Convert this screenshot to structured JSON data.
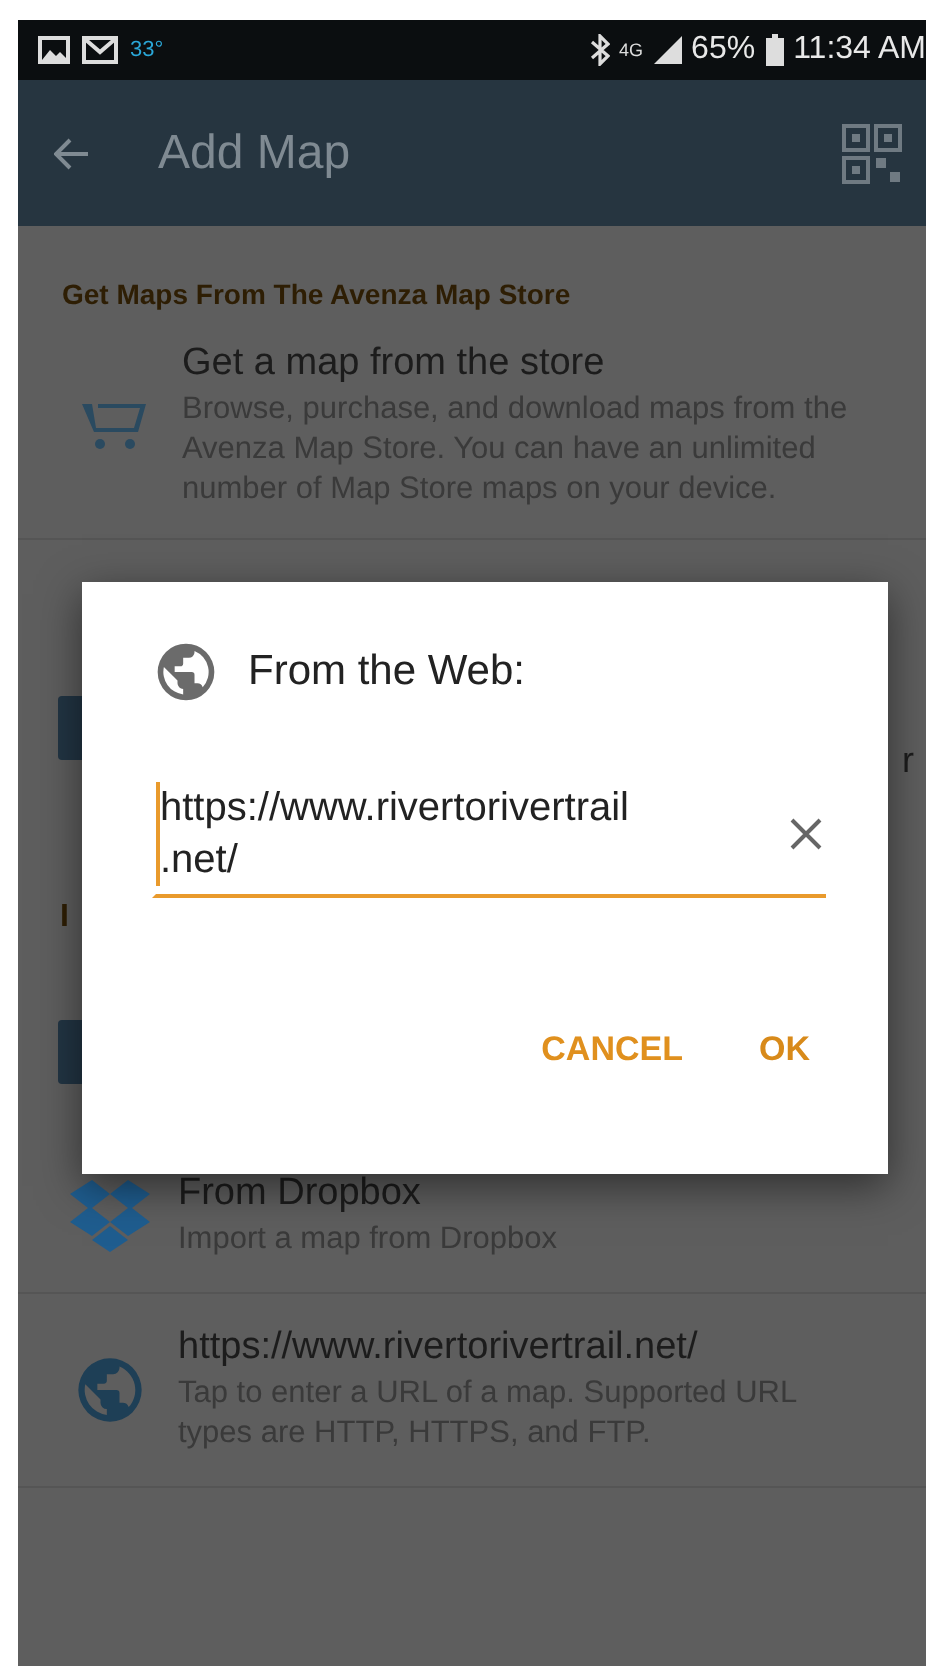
{
  "status_bar": {
    "temperature": "33°",
    "network": "4G",
    "battery": "65%",
    "time": "11:34 AM"
  },
  "app_bar": {
    "title": "Add Map"
  },
  "store_section": {
    "header": "Get Maps From The Avenza Map Store",
    "item": {
      "title": "Get a map from the store",
      "subtitle": "Browse, purchase, and download maps from the Avenza Map Store. You can have an unlimited number of Map Store maps on your device."
    }
  },
  "covered": {
    "row_fragment": "r",
    "header_fragment": "I"
  },
  "dialog": {
    "title": "From the Web:",
    "field": {
      "value": "https://www.rivertorivertrail\n.net/"
    },
    "buttons": [
      {
        "label": "CANCEL",
        "kind": "cancel"
      },
      {
        "label": "OK",
        "kind": "ok"
      }
    ]
  },
  "import_items": [
    {
      "kind": "dropbox",
      "title": "From Dropbox",
      "subtitle": "Import a map from Dropbox"
    },
    {
      "kind": "web",
      "title": "https://www.rivertorivertrail.net/",
      "subtitle": "Tap to enter a URL of a map. Supported URL types are HTTP, HTTPS, and FTP."
    }
  ]
}
